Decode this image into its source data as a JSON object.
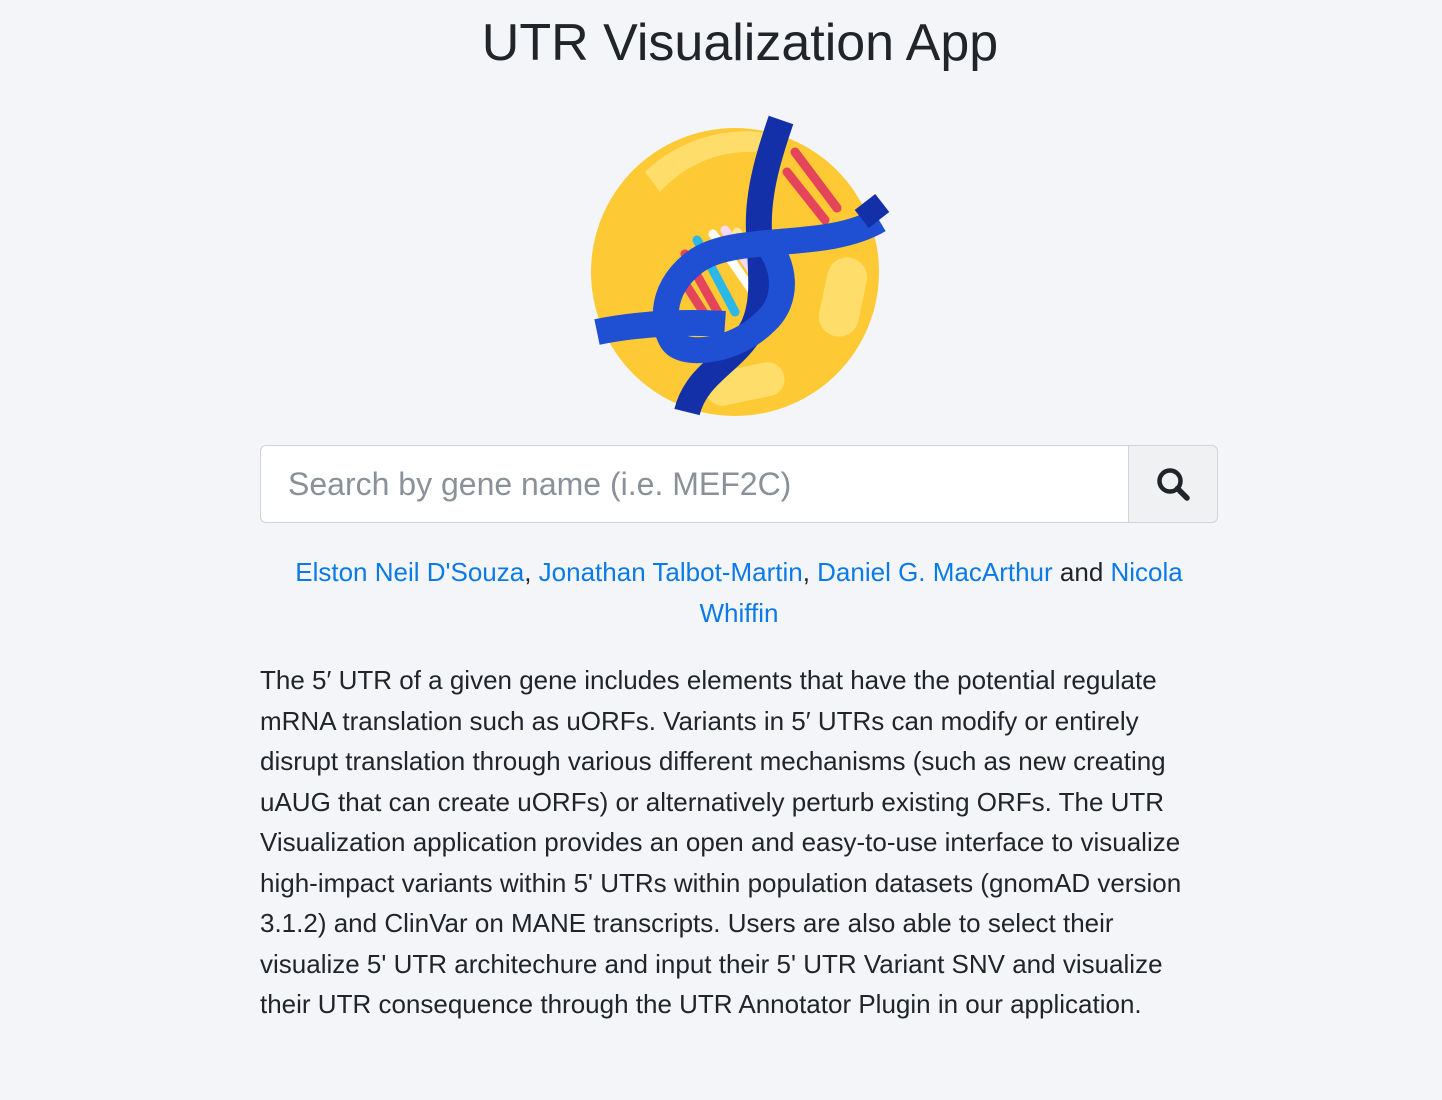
{
  "header": {
    "title": "UTR Visualization App"
  },
  "logo": {
    "icon": "dna-icon",
    "colors": {
      "circle": "#fdc934",
      "helix": "#1f4fd3",
      "helix_dark": "#1330a8",
      "rung_red": "#e5455a",
      "rung_cyan": "#2bb8e6",
      "rung_white": "#ffffff"
    }
  },
  "search": {
    "placeholder": "Search by gene name (i.e. MEF2C)",
    "value": "",
    "button_icon": "search-icon"
  },
  "authors": {
    "names": [
      "Elston Neil D'Souza",
      "Jonathan Talbot-Martin",
      "Daniel G. MacArthur",
      "Nicola Whiffin"
    ],
    "separator": ", ",
    "conjunction": " and "
  },
  "description": "The 5′ UTR of a given gene includes elements that have the potential regulate mRNA translation such as uORFs. Variants in 5′ UTRs can modify or entirely disrupt translation through various different mechanisms (such as new creating uAUG that can create uORFs) or alternatively perturb existing ORFs. The UTR Visualization application provides an open and easy-to-use interface to visualize high-impact variants within 5' UTRs within population datasets (gnomAD version 3.1.2) and ClinVar on MANE transcripts. Users are also able to select their visualize 5' UTR architechure and input their 5' UTR Variant SNV and visualize their UTR consequence through the UTR Annotator Plugin in our application.",
  "theme": {
    "background": "#f4f5f8",
    "link": "#0a7ae6",
    "text": "#212529"
  }
}
